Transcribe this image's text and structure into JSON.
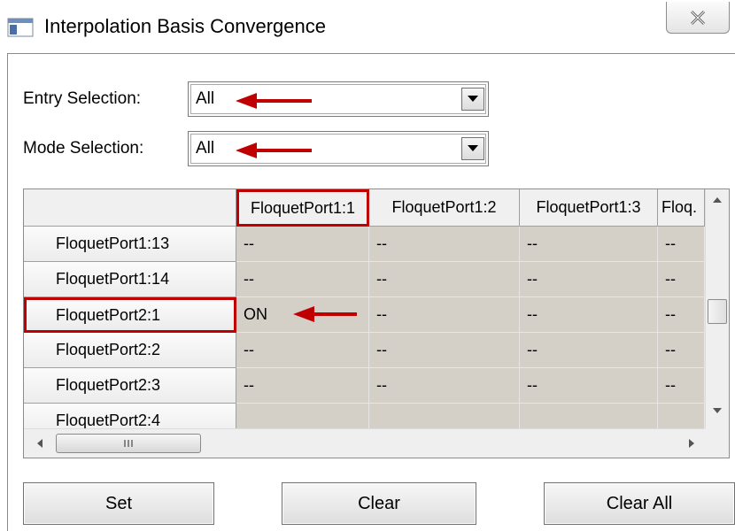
{
  "window": {
    "title": "Interpolation Basis Convergence"
  },
  "entry_selection": {
    "label": "Entry Selection:",
    "value": "All"
  },
  "mode_selection": {
    "label": "Mode Selection:",
    "value": "All"
  },
  "grid": {
    "columns": [
      "FloquetPort1:1",
      "FloquetPort1:2",
      "FloquetPort1:3",
      "Floq."
    ],
    "selected_column": "FloquetPort1:1",
    "rows": [
      {
        "label": "FloquetPort1:13",
        "cells": [
          "--",
          "--",
          "--",
          "--"
        ]
      },
      {
        "label": "FloquetPort1:14",
        "cells": [
          "--",
          "--",
          "--",
          "--"
        ]
      },
      {
        "label": "FloquetPort2:1",
        "cells": [
          "ON",
          "--",
          "--",
          "--"
        ]
      },
      {
        "label": "FloquetPort2:2",
        "cells": [
          "--",
          "--",
          "--",
          "--"
        ]
      },
      {
        "label": "FloquetPort2:3",
        "cells": [
          "--",
          "--",
          "--",
          "--"
        ]
      },
      {
        "label": "FloquetPort2:4",
        "cells": [
          "",
          "",
          "",
          ""
        ]
      }
    ],
    "selected_row": "FloquetPort2:1"
  },
  "buttons": {
    "set": "Set",
    "clear": "Clear",
    "clear_all": "Clear All"
  },
  "colors": {
    "highlight": "#c00000",
    "cell_bg": "#d4d0c8"
  }
}
